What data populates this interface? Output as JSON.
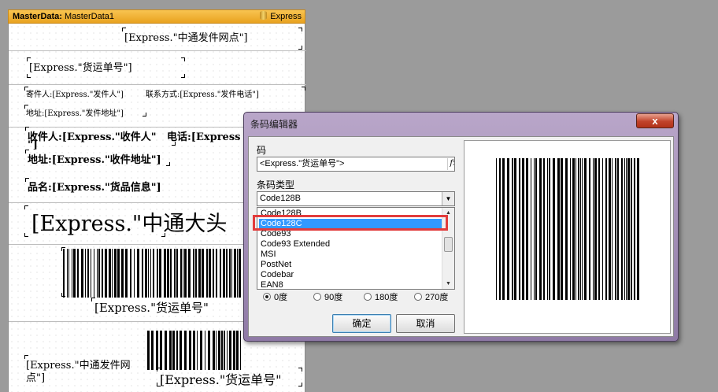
{
  "band": {
    "header_bold": "MasterData:",
    "header_name": "MasterData1",
    "datasource": "Express"
  },
  "report": {
    "site_field": "[Express.\"中通发件网点\"]",
    "waybill_field": "[Express.\"货运单号\"]",
    "sender_line": "寄件人:[Express.\"发件人\"]",
    "sender_phone_line": "联系方式:[Express.\"发件电话\"]",
    "sender_address_line": "地址:[Express.\"发件地址\"]",
    "receiver_line": "收件人:[Express.\"收件人\"",
    "receiver_phone_line": "电话:[Express",
    "receiver_wrap": "\"]",
    "receiver_address_line": "地址:[Express.\"收件地址\"]",
    "goods_line": "品名:[Express.\"货品信息\"]",
    "big_field": "[Express.\"中通大头",
    "barcode_caption": "[Express.\"货运单号\"",
    "bottom_site_line1": "[Express.\"中通发件网",
    "bottom_site_line2": "点\"]",
    "bottom_waybill": "[Express.\"货运单号\""
  },
  "dialog": {
    "title": "条码编辑器",
    "close": "x",
    "code_label": "码",
    "code_value": "<Express.\"货运单号\">",
    "fx": "fx",
    "type_label": "条码类型",
    "selected_type": "Code128B",
    "type_options": [
      "Code128B",
      "Code128C",
      "Code93",
      "Code93 Extended",
      "MSI",
      "PostNet",
      "Codebar",
      "EAN8"
    ],
    "highlighted_option": "Code128C",
    "rotations": [
      "0度",
      "90度",
      "180度",
      "270度"
    ],
    "selected_rotation": "0度",
    "ok": "确定",
    "cancel": "取消"
  }
}
